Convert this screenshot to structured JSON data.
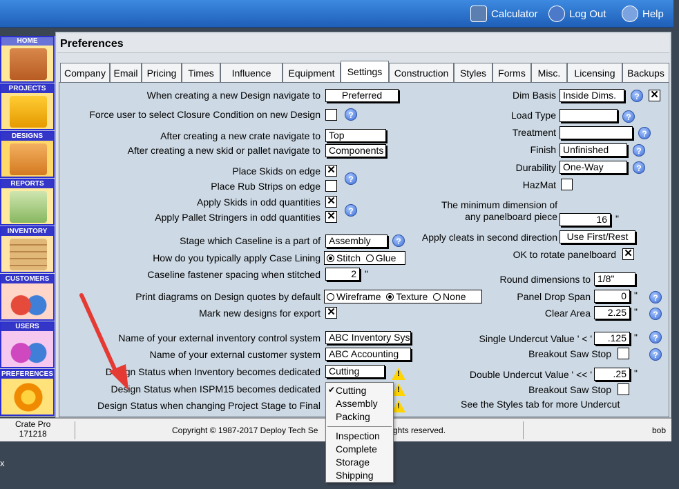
{
  "topbar": {
    "items": [
      {
        "label": "Calculator",
        "color": "#5b7fb0"
      },
      {
        "label": "Log Out",
        "color": "#4c79c8"
      },
      {
        "label": "Help",
        "color": "#7aa3e0"
      }
    ]
  },
  "sidebar": {
    "items": [
      "HOME",
      "PROJECTS",
      "DESIGNS",
      "REPORTS",
      "INVENTORY",
      "CUSTOMERS",
      "USERS",
      "PREFERENCES"
    ]
  },
  "page": {
    "title": "Preferences"
  },
  "tabs": [
    "Company",
    "Email",
    "Pricing",
    "Times",
    "Influence",
    "Equipment",
    "Settings",
    "Construction",
    "Styles",
    "Forms",
    "Misc.",
    "Licensing",
    "Backups"
  ],
  "left": {
    "nav_design_label": "When creating a new Design navigate to",
    "nav_design_value": "Preferred",
    "closure_label": "Force user to select Closure Condition on new Design",
    "nav_crate_label": "After creating a new crate navigate to",
    "nav_crate_value": "Top",
    "nav_skid_label": "After creating a new skid or pallet navigate to",
    "nav_skid_value": "Components",
    "skids_edge_label": "Place Skids on edge",
    "rub_strips_label": "Place Rub Strips on edge",
    "skids_odd_label": "Apply Skids in odd quantities",
    "stringers_odd_label": "Apply Pallet Stringers in odd quantities",
    "stage_label": "Stage which Caseline is a part of",
    "stage_value": "Assembly",
    "lining_label": "How do you typically apply Case Lining",
    "lining_opt1": "Stitch",
    "lining_opt2": "Glue",
    "fastener_label": "Caseline fastener spacing when stitched",
    "fastener_value": "2",
    "fastener_unit": "\"",
    "diagrams_label": "Print diagrams on Design quotes by default",
    "diag_opt1": "Wireframe",
    "diag_opt2": "Texture",
    "diag_opt3": "None",
    "export_label": "Mark new designs for export",
    "inv_sys_label": "Name of your external inventory control system",
    "inv_sys_value": "ABC Inventory Sys",
    "cust_sys_label": "Name of your external customer system",
    "cust_sys_value": "ABC Accounting",
    "status_inv_label": "Design Status when Inventory becomes dedicated",
    "status_inv_value": "Cutting",
    "status_ispm_label": "Design Status when ISPM15 becomes dedicated",
    "status_final_label": "Design Status when changing Project Stage to Final"
  },
  "right": {
    "dim_basis_label": "Dim Basis",
    "dim_basis_value": "Inside Dims.",
    "load_type_label": "Load Type",
    "load_type_value": "",
    "treatment_label": "Treatment",
    "treatment_value": "",
    "finish_label": "Finish",
    "finish_value": "Unfinished",
    "durability_label": "Durability",
    "durability_value": "One-Way",
    "hazmat_label": "HazMat",
    "min_dim_label1": "The minimum dimension of",
    "min_dim_label2": "any panelboard piece",
    "min_dim_value": "16",
    "min_dim_unit": "\"",
    "cleats_label": "Apply cleats in second direction",
    "cleats_value": "Use First/Rest",
    "rotate_label": "OK to rotate panelboard",
    "round_label": "Round dimensions to",
    "round_value": "1/8\"",
    "drop_span_label": "Panel Drop Span",
    "drop_span_value": "0",
    "drop_span_unit": "\"",
    "clear_area_label": "Clear Area",
    "clear_area_value": "2.25",
    "clear_area_unit": "\"",
    "single_uc_label": "Single Undercut Value  ' < '",
    "single_uc_value": ".125",
    "single_uc_unit": "\"",
    "breakout1_label": "Breakout Saw Stop",
    "double_uc_label": "Double Undercut Value ' << '",
    "double_uc_value": ".25",
    "double_uc_unit": "\"",
    "breakout2_label": "Breakout Saw Stop",
    "styles_note": "See the Styles tab for more Undercut"
  },
  "dropdown": {
    "items": [
      "Cutting",
      "Assembly",
      "Packing",
      "Inspection",
      "Complete",
      "Storage",
      "Shipping"
    ],
    "check": "✔"
  },
  "footer": {
    "app_name": "Crate Pro",
    "version": "171218",
    "copyright": "Copyright © 1987-2017  Deploy Tech Se",
    "rights": "ghts reserved.",
    "user": "bob"
  },
  "corner_text": "x",
  "glyphs": {
    "check": "✕",
    "help": "?",
    "warn": "!"
  }
}
